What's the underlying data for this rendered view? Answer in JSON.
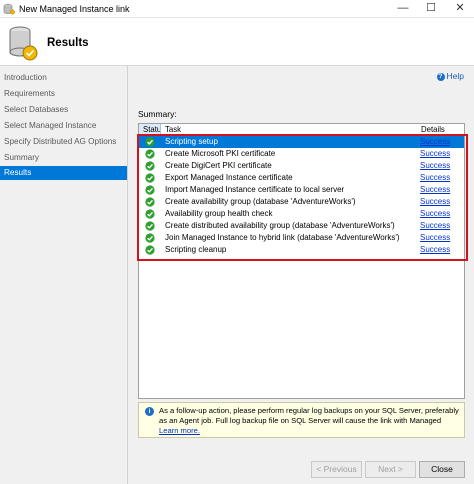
{
  "window": {
    "title": "New Managed Instance link",
    "app_icon": "database-icon",
    "controls": [
      "minimize-icon",
      "maximize-icon",
      "close-icon"
    ]
  },
  "header": {
    "title": "Results"
  },
  "sidebar": {
    "items": [
      {
        "label": "Introduction",
        "active": false
      },
      {
        "label": "Requirements",
        "active": false
      },
      {
        "label": "Select Databases",
        "active": false
      },
      {
        "label": "Select Managed Instance",
        "active": false
      },
      {
        "label": "Specify Distributed AG Options",
        "active": false
      },
      {
        "label": "Summary",
        "active": false
      },
      {
        "label": "Results",
        "active": true
      }
    ]
  },
  "help": {
    "label": "Help"
  },
  "summary": {
    "label": "Summary:",
    "columns": {
      "status": "Status",
      "task": "Task",
      "details": "Details"
    },
    "rows": [
      {
        "status": "success-check-icon",
        "task": "Scripting setup",
        "details": "Success"
      },
      {
        "status": "success-check-icon",
        "task": "Create Microsoft PKI certificate",
        "details": "Success"
      },
      {
        "status": "success-check-icon",
        "task": "Create DigiCert PKI certificate",
        "details": "Success"
      },
      {
        "status": "success-check-icon",
        "task": "Export Managed Instance certificate",
        "details": "Success"
      },
      {
        "status": "success-check-icon",
        "task": "Import Managed Instance certificate to local server",
        "details": "Success"
      },
      {
        "status": "success-check-icon",
        "task": "Create availability group (database 'AdventureWorks')",
        "details": "Success"
      },
      {
        "status": "success-check-icon",
        "task": "Availability group health check",
        "details": "Success"
      },
      {
        "status": "success-check-icon",
        "task": "Create distributed availability group (database 'AdventureWorks')",
        "details": "Success"
      },
      {
        "status": "success-check-icon",
        "task": "Join Managed Instance to hybrid link (database 'AdventureWorks')",
        "details": "Success"
      },
      {
        "status": "success-check-icon",
        "task": "Scripting cleanup",
        "details": "Success"
      }
    ],
    "highlight_color": "#d2121c"
  },
  "info": {
    "line1": "As a follow-up action, please perform regular log backups on your SQL Server, preferably",
    "line2": "as an Agent job. Full log backup file on SQL Server will cause the link with Managed",
    "link": "Learn more."
  },
  "buttons": {
    "previous": "< Previous",
    "next": "Next >",
    "close": "Close"
  },
  "colors": {
    "accent": "#0078d7",
    "success": "#2e9e2e",
    "link": "#0033cc"
  }
}
